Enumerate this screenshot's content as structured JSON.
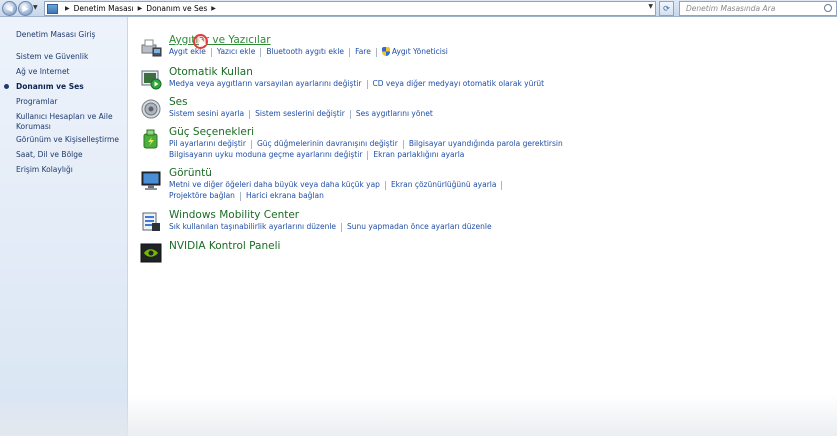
{
  "address_bar": {
    "crumbs": [
      "Denetim Masası",
      "Donanım ve Ses"
    ]
  },
  "search": {
    "placeholder": "Denetim Masasında Ara"
  },
  "sidebar": {
    "items": [
      {
        "label": "Denetim Masası Giriş"
      },
      {
        "label": "Sistem ve Güvenlik"
      },
      {
        "label": "Ağ ve Internet"
      },
      {
        "label": "Donanım ve Ses",
        "current": true
      },
      {
        "label": "Programlar"
      },
      {
        "label": "Kullanıcı Hesapları ve Aile Koruması"
      },
      {
        "label": "Görünüm ve Kişiselleştirme"
      },
      {
        "label": "Saat, Dil ve Bölge"
      },
      {
        "label": "Erişim Kolaylığı"
      }
    ]
  },
  "categories": [
    {
      "title": "Aygıtlar ve Yazıcılar",
      "icon": "printer-icon",
      "rows": [
        [
          "Aygıt ekle",
          "Yazıcı ekle",
          "Bluetooth aygıtı ekle",
          "Fare",
          "Aygıt Yöneticisi"
        ]
      ]
    },
    {
      "title": "Otomatik Kullan",
      "icon": "autoplay-icon",
      "rows": [
        [
          "Medya veya aygıtların varsayılan ayarlarını değiştir",
          "CD veya diğer medyayı otomatik olarak yürüt"
        ]
      ]
    },
    {
      "title": "Ses",
      "icon": "speaker-icon",
      "rows": [
        [
          "Sistem sesini ayarla",
          "Sistem seslerini değiştir",
          "Ses aygıtlarını yönet"
        ]
      ]
    },
    {
      "title": "Güç Seçenekleri",
      "icon": "power-icon",
      "rows": [
        [
          "Pil ayarlarını değiştir",
          "Güç düğmelerinin davranışını değiştir",
          "Bilgisayar uyandığında parola gerektirsin"
        ],
        [
          "Bilgisayarın uyku moduna geçme ayarlarını değiştir",
          "Ekran parlaklığını ayarla"
        ]
      ]
    },
    {
      "title": "Görüntü",
      "icon": "display-icon",
      "rows": [
        [
          "Metni ve diğer öğeleri daha büyük veya daha küçük yap",
          "Ekran çözünürlüğünü ayarla"
        ],
        [
          "Projektöre bağlan",
          "Harici ekrana bağlan"
        ]
      ]
    },
    {
      "title": "Windows Mobility Center",
      "icon": "mobility-icon",
      "rows": [
        [
          "Sık kullanılan taşınabilirlik ayarlarını düzenle",
          "Sunu yapmadan önce ayarları düzenle"
        ]
      ]
    },
    {
      "title": "NVIDIA Kontrol Paneli",
      "icon": "nvidia-icon",
      "rows": []
    }
  ],
  "colors": {
    "title_green": "#1a6b24",
    "link_blue": "#1f4ea8",
    "sidebar_link": "#1e3a6e"
  }
}
